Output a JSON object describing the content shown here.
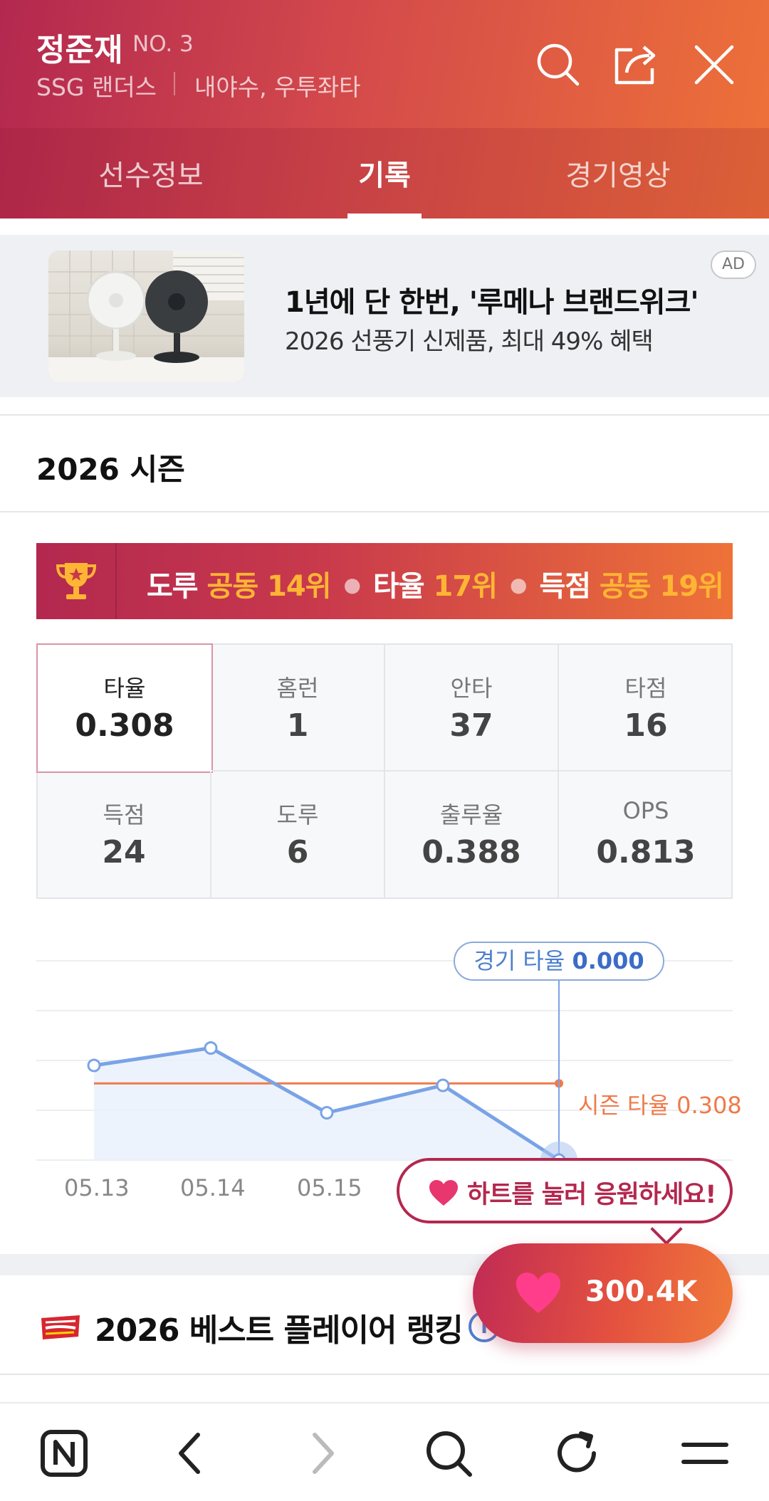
{
  "header": {
    "player_name": "정준재",
    "player_number": "NO. 3",
    "team": "SSG 랜더스",
    "position": "내야수, 우투좌타",
    "icons": [
      "search-icon",
      "share-icon",
      "close-icon"
    ]
  },
  "tabs": [
    {
      "label": "선수정보",
      "active": false
    },
    {
      "label": "기록",
      "active": true
    },
    {
      "label": "경기영상",
      "active": false
    }
  ],
  "ad": {
    "title": "1년에 단 한번, '루메나 브랜드위크'",
    "subtitle": "2026 선풍기 신제품, 최대 49% 혜택",
    "badge": "AD"
  },
  "season": {
    "title": "2026 시즌"
  },
  "rank_banner": [
    {
      "category": "도루",
      "rank": "공동 14위"
    },
    {
      "category": "타율",
      "rank": "17위"
    },
    {
      "category": "득점",
      "rank": "공동 19위"
    }
  ],
  "stats": [
    {
      "label": "타율",
      "value": "0.308",
      "selected": true
    },
    {
      "label": "홈런",
      "value": "1"
    },
    {
      "label": "안타",
      "value": "37"
    },
    {
      "label": "타점",
      "value": "16"
    },
    {
      "label": "득점",
      "value": "24"
    },
    {
      "label": "도루",
      "value": "6"
    },
    {
      "label": "출루율",
      "value": "0.388"
    },
    {
      "label": "OPS",
      "value": "0.813"
    }
  ],
  "chart": {
    "tooltip_label": "경기 타율",
    "tooltip_value": "0.000",
    "season_avg_label": "시즌 타율 0.308",
    "x_labels": [
      "05.13",
      "05.14",
      "05.15"
    ]
  },
  "chart_data": {
    "type": "line",
    "x": [
      "05.13",
      "05.14",
      "05.15",
      "",
      ""
    ],
    "series": [
      {
        "values": [
          0.38,
          0.45,
          0.19,
          0.3,
          0.0
        ]
      }
    ],
    "reference_line": 0.308,
    "ylim": [
      0,
      0.8
    ],
    "grid": true
  },
  "cheer": {
    "bubble_text": "하트를 눌러 응원하세요!",
    "heart_count": "300.4K"
  },
  "ranking": {
    "title": "2026 베스트 플레이어 랭킹"
  },
  "bottom_nav": [
    "naver-home-icon",
    "back-icon",
    "forward-icon",
    "search-icon",
    "refresh-icon",
    "menu-icon"
  ],
  "colors": {
    "header_start": "#b3284f",
    "header_end": "#ee7238",
    "rank_highlight": "#ffb534",
    "chart_line": "#7aa3e6",
    "season_line": "#f07a4a",
    "accent": "#b3284f"
  }
}
